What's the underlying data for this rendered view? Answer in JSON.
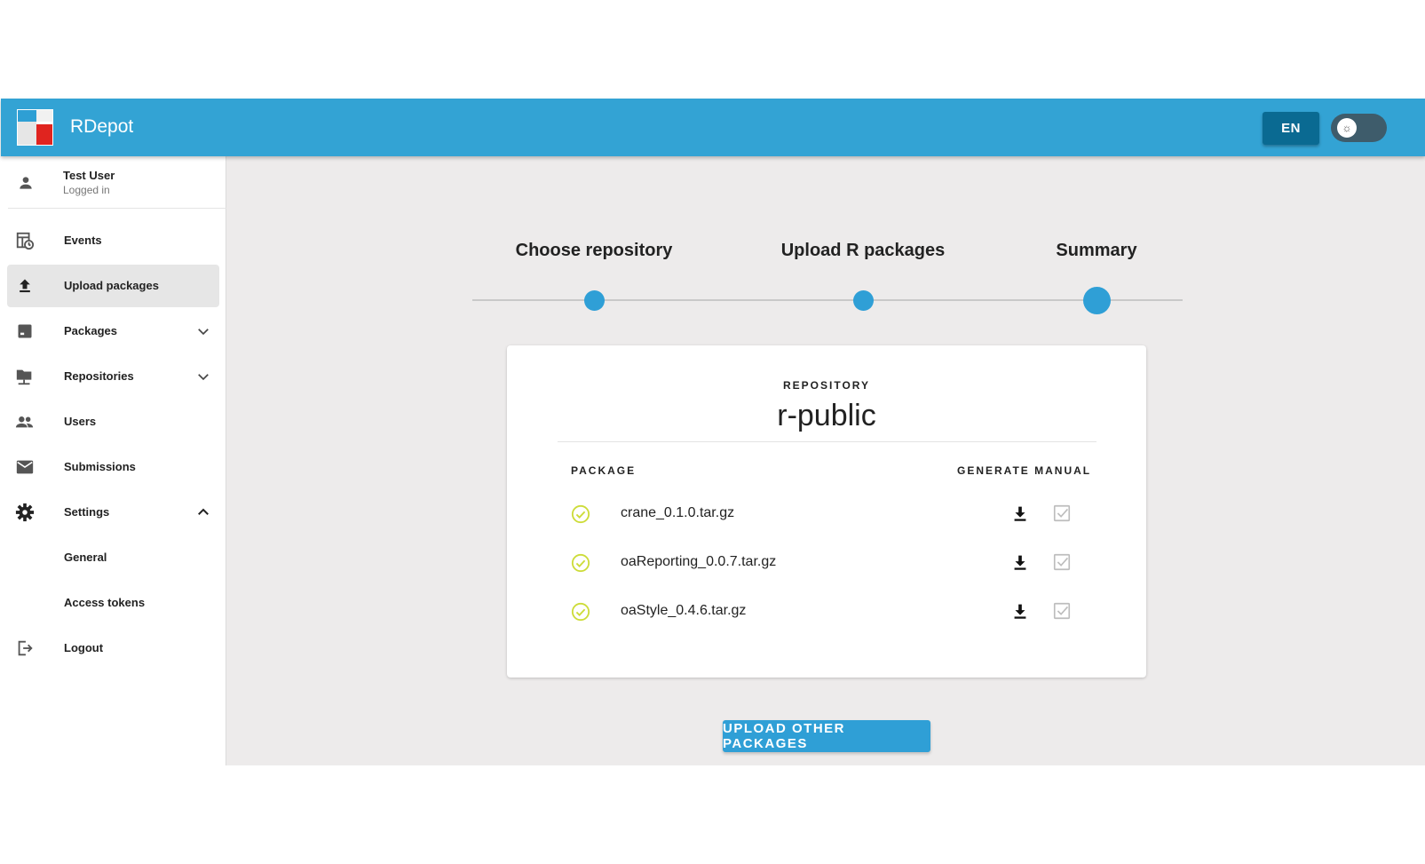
{
  "app": {
    "title": "RDepot"
  },
  "header": {
    "language": "EN",
    "theme_toggle_icon": "sun-icon"
  },
  "user": {
    "name": "Test User",
    "status": "Logged in"
  },
  "sidebar": {
    "items": [
      {
        "label": "Events",
        "icon": "events-icon"
      },
      {
        "label": "Upload packages",
        "icon": "upload-icon",
        "active": true
      },
      {
        "label": "Packages",
        "icon": "package-icon",
        "expandable": "collapsed"
      },
      {
        "label": "Repositories",
        "icon": "repository-icon",
        "expandable": "collapsed"
      },
      {
        "label": "Users",
        "icon": "users-icon"
      },
      {
        "label": "Submissions",
        "icon": "mail-icon"
      },
      {
        "label": "Settings",
        "icon": "gear-icon",
        "expandable": "expanded"
      },
      {
        "label": "General",
        "sub": true
      },
      {
        "label": "Access tokens",
        "sub": true
      },
      {
        "label": "Logout",
        "icon": "logout-icon"
      }
    ]
  },
  "stepper": {
    "steps": [
      "Choose repository",
      "Upload R packages",
      "Summary"
    ],
    "active_step": 3
  },
  "summary": {
    "repo_caption": "REPOSITORY",
    "repo_name": "r-public",
    "col_package": "PACKAGE",
    "col_generate_manual": "GENERATE MANUAL",
    "packages": [
      {
        "name": "crane_0.1.0.tar.gz",
        "status": "success"
      },
      {
        "name": "oaReporting_0.0.7.tar.gz",
        "status": "success"
      },
      {
        "name": "oaStyle_0.4.6.tar.gz",
        "status": "success"
      }
    ]
  },
  "actions": {
    "upload_other": "UPLOAD OTHER PACKAGES"
  },
  "colors": {
    "primary": "#33a3d4",
    "dark_primary": "#0a6a92",
    "success": "#cddc39",
    "background": "#edebeb"
  }
}
